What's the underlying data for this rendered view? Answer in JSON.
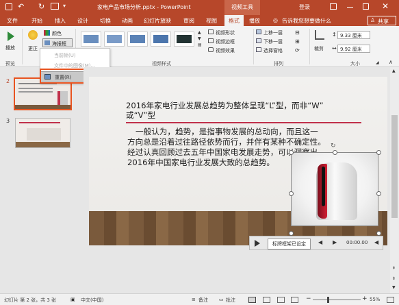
{
  "titlebar": {
    "document_title": "家电产品市场分析.pptx - PowerPoint",
    "context_tab": "视频工具",
    "sign_in": "登录"
  },
  "tabs": [
    "文件",
    "开始",
    "插入",
    "设计",
    "切换",
    "动画",
    "幻灯片放映",
    "审阅",
    "视图",
    "格式",
    "播放"
  ],
  "tell_me": "告诉我您想要做什么",
  "share": "共享",
  "ribbon": {
    "play": "播放",
    "correct": "更正",
    "color": "颜色",
    "poster_frame": "海报框",
    "video_shape": "视频形状",
    "video_border": "视频边框",
    "video_effects": "视频效果",
    "bring_forward": "上移一层",
    "send_backward": "下移一层",
    "selection_pane": "选择窗格",
    "crop": "裁剪",
    "height": "9.33 厘米",
    "width": "9.92 厘米",
    "groups": {
      "preview": "预览",
      "video_styles": "视频样式",
      "arrange": "排列",
      "size": "大小"
    }
  },
  "poster_menu": {
    "items": [
      "当前帧(U)",
      "文件中的图像(M)...",
      "重置(R)"
    ]
  },
  "callout": "单击",
  "thumbnails": [
    {
      "number": "2"
    },
    {
      "number": "3"
    }
  ],
  "slide": {
    "title_line1": "2016年家电行业发展总趋势为整体呈现“L”型，而非“W”",
    "title_line2": "或“V”型",
    "body": [
      "一般认为，趋势，是指事物发展的总动向，而且这一",
      "方向总是沿着过往路径依势而行，并伴有某种不确定性。",
      "经过认真回顾过去五年中国家电发展走势，可以洞察出",
      "2016年中国家电行业发展大致的总趋势。"
    ]
  },
  "video_controls": {
    "tooltip": "标牌框架已设定",
    "time": "00:00.00"
  },
  "status": {
    "slide_info": "幻灯片 第 2 张，共 3 张",
    "language": "中文(中国)",
    "notes": "备注",
    "comments": "批注",
    "zoom": "55%"
  },
  "colors": {
    "accent": "#b7472a",
    "callout": "#e8531f",
    "title_underline": "#c0304a"
  }
}
